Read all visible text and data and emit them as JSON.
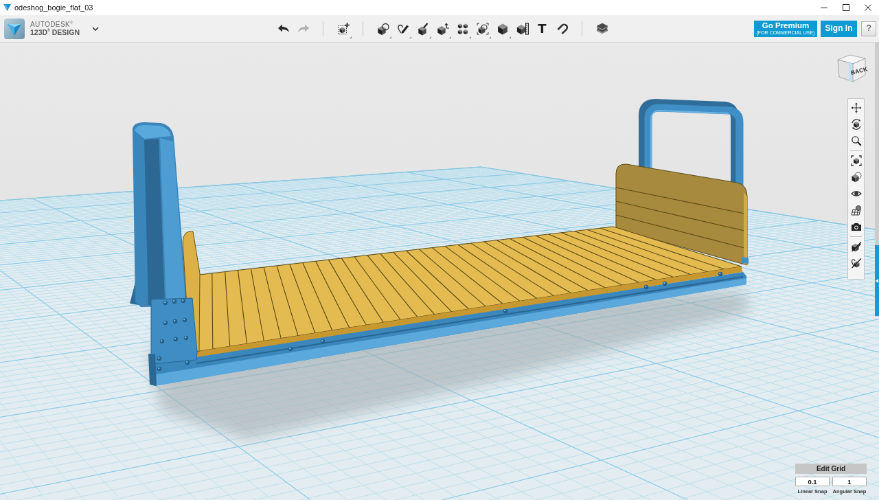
{
  "window": {
    "title": "odeshog_bogie_flat_03"
  },
  "brand": {
    "company": "AUTODESK$^{®}$",
    "product": "123D$^{®}$ DESIGN"
  },
  "toolbar": {
    "groups": [
      {
        "tools": [
          {
            "kind": "undo",
            "menu": false,
            "disabled": false
          },
          {
            "kind": "redo",
            "menu": false,
            "disabled": true
          }
        ]
      },
      {
        "tools": [
          {
            "kind": "transform",
            "menu": true,
            "disabled": false
          }
        ]
      },
      {
        "tools": [
          {
            "kind": "primitives",
            "menu": true,
            "disabled": false
          },
          {
            "kind": "sketch",
            "menu": true,
            "disabled": false
          },
          {
            "kind": "construct",
            "menu": true,
            "disabled": false
          },
          {
            "kind": "modify",
            "menu": true,
            "disabled": false
          },
          {
            "kind": "pattern",
            "menu": true,
            "disabled": false
          },
          {
            "kind": "grouping",
            "menu": true,
            "disabled": false
          },
          {
            "kind": "combine",
            "menu": true,
            "disabled": false
          },
          {
            "kind": "measure",
            "menu": false,
            "disabled": false
          },
          {
            "kind": "text",
            "glyph": "T",
            "menu": false,
            "disabled": false
          },
          {
            "kind": "snap",
            "menu": false,
            "disabled": false
          }
        ]
      },
      {
        "tools": [
          {
            "kind": "material",
            "menu": false,
            "disabled": false
          }
        ]
      }
    ]
  },
  "account": [
    {
      "kind": "premium",
      "label": "Go Premium",
      "note": "(FOR COMMERCIAL USE)"
    },
    {
      "kind": "sign_in",
      "label": "Sign In"
    },
    {
      "kind": "help",
      "label": "?"
    }
  ],
  "view_cube": {
    "face": "BACK"
  },
  "navigation": {
    "groups": [
      {
        "tools": [
          {
            "kind": "pan"
          },
          {
            "kind": "orbit"
          },
          {
            "kind": "zoom"
          }
        ]
      },
      {
        "tools": [
          {
            "kind": "fit"
          },
          {
            "kind": "view"
          },
          {
            "kind": "visibility"
          },
          {
            "kind": "display"
          },
          {
            "kind": "capture"
          }
        ]
      },
      {
        "tools": [
          {
            "kind": "hide_sketch"
          },
          {
            "kind": "hide_mesh"
          }
        ]
      }
    ]
  },
  "grid_panel": {
    "button": "Edit Grid",
    "fields": [
      {
        "value": "0.1",
        "label": "Linear Snap"
      },
      {
        "value": "1",
        "label": "Angular Snap"
      }
    ]
  }
}
